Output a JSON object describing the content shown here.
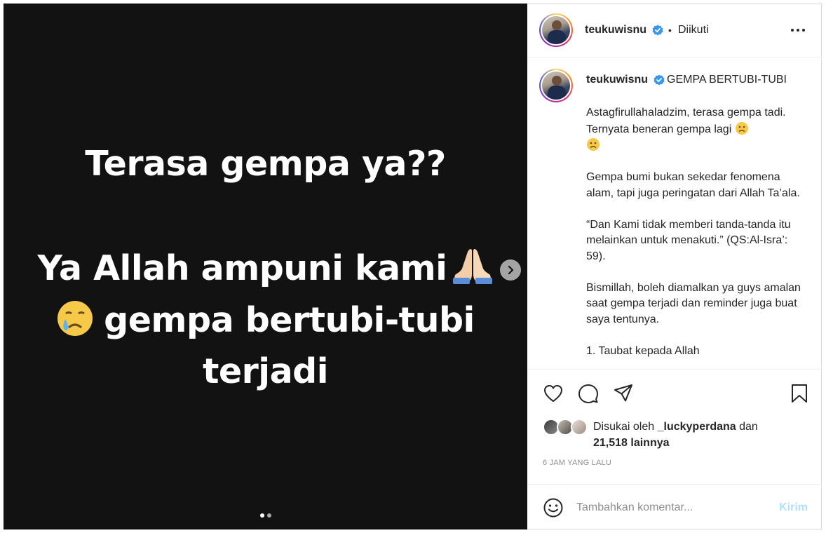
{
  "media": {
    "lines": [
      "Terasa gempa ya??",
      "Ya Allah ampuni kami",
      "gempa bertubi-tubi",
      "terjadi"
    ],
    "emoji": {
      "pray": "folded-hands-emoji",
      "cry": "crying-face-emoji"
    },
    "slide_count": 2,
    "active_slide": 1
  },
  "header": {
    "username": "teukuwisnu",
    "bullet": "•",
    "follow_state": "Diikuti"
  },
  "caption": {
    "username": "teukuwisnu",
    "title": "GEMPA BERTUBI-TUBI",
    "paragraphs": [
      "Astagfirullahaladzim, terasa gempa tadi. Ternyata beneran gempa lagi",
      "Gempa bumi bukan sekedar fenomena alam, tapi juga peringatan dari Allah Ta’ala.",
      "“Dan Kami tidak memberi tanda-tanda itu melainkan untuk menakuti.” (QS:Al-Isra’: 59).",
      "Bismillah, boleh diamalkan ya guys amalan saat gempa terjadi dan reminder juga buat saya tentunya.",
      "1. Taubat kepada Allah"
    ]
  },
  "likes": {
    "prefix": "Disukai oleh",
    "liker": "_luckyperdana",
    "connector": "dan",
    "others": "21,518 lainnya"
  },
  "timestamp": "6 JAM YANG LALU",
  "comment": {
    "placeholder": "Tambahkan komentar...",
    "post_label": "Kirim"
  },
  "colors": {
    "media_bg": "#121212",
    "verified_blue": "#3897f0",
    "post_disabled": "#b2dffc",
    "muted": "#8e8e8e"
  }
}
